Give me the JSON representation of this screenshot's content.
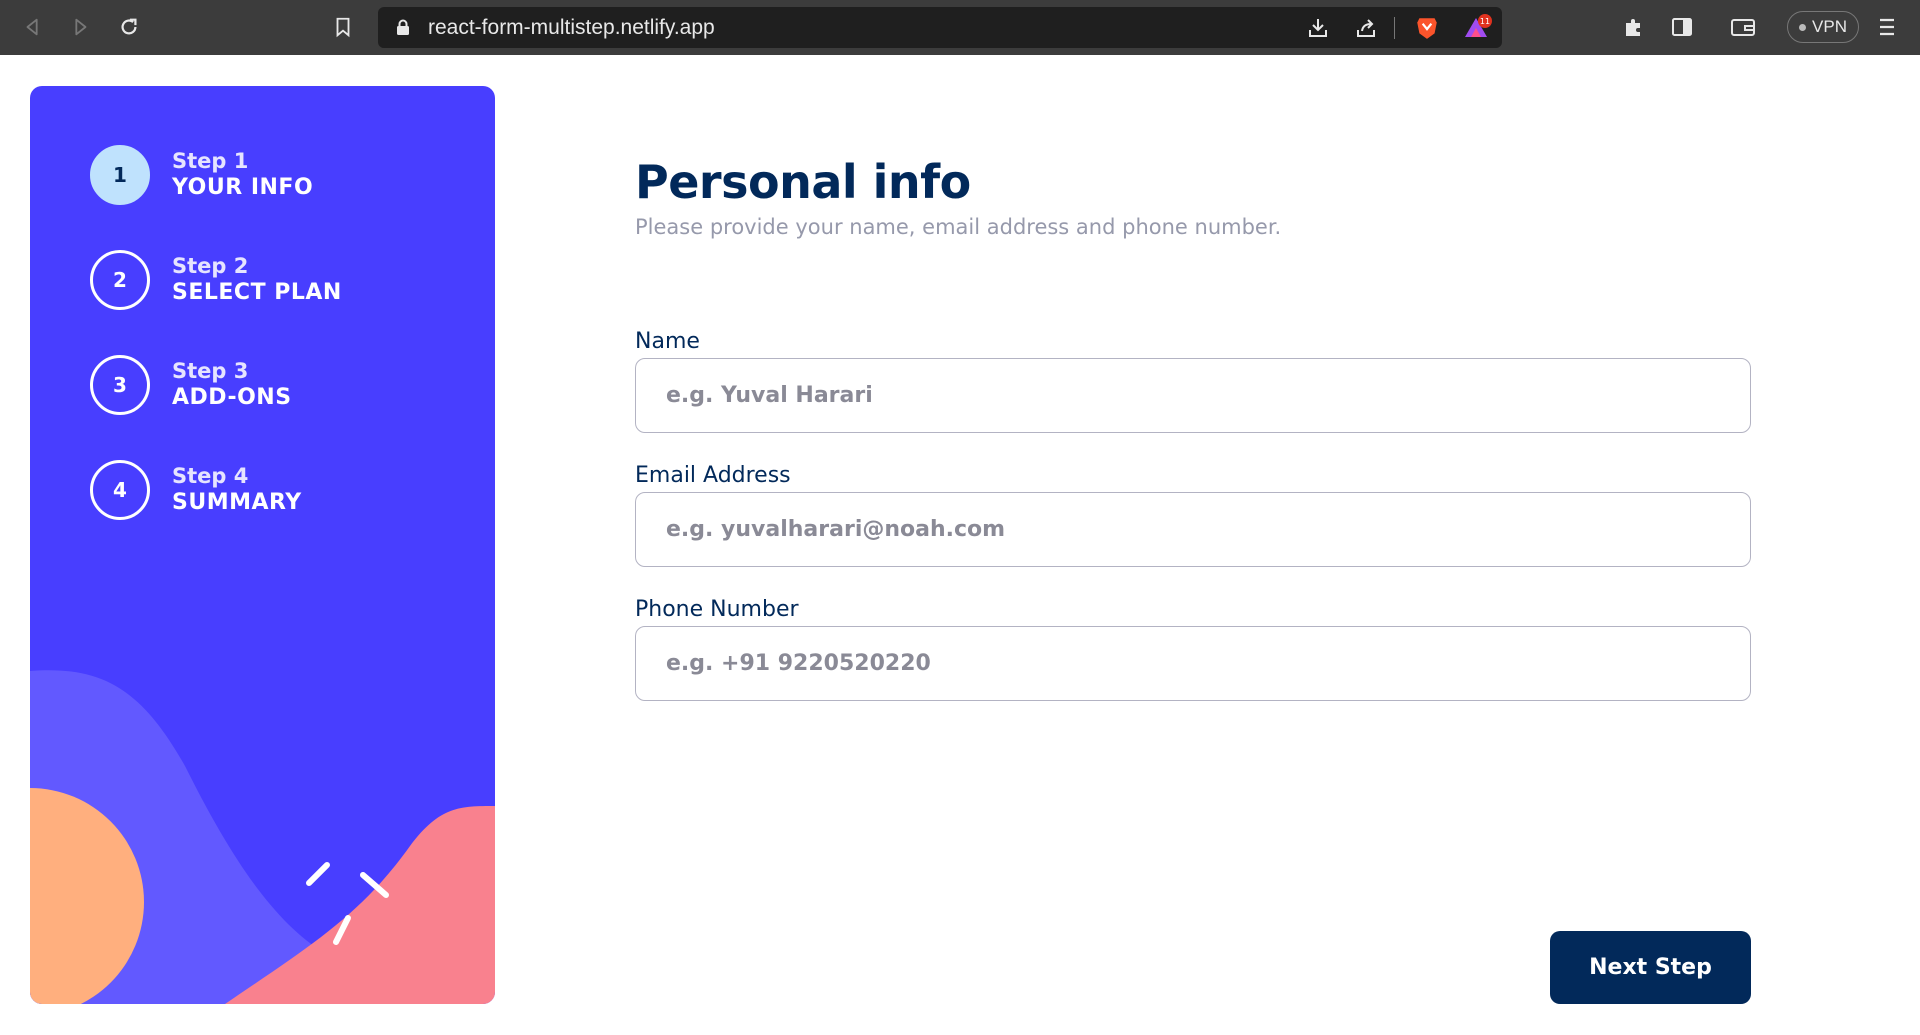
{
  "browser": {
    "url": "react-form-multistep.netlify.app",
    "vpn_label": "VPN",
    "notification_badge": "11"
  },
  "sidebar": {
    "steps": [
      {
        "number": "1",
        "label": "Step 1",
        "title": "YOUR INFO",
        "active": true
      },
      {
        "number": "2",
        "label": "Step 2",
        "title": "SELECT PLAN",
        "active": false
      },
      {
        "number": "3",
        "label": "Step 3",
        "title": "ADD-ONS",
        "active": false
      },
      {
        "number": "4",
        "label": "Step 4",
        "title": "SUMMARY",
        "active": false
      }
    ]
  },
  "form": {
    "title": "Personal info",
    "subtitle": "Please provide your name, email address and phone number.",
    "name": {
      "label": "Name",
      "placeholder": "e.g. Yuval Harari",
      "value": ""
    },
    "email": {
      "label": "Email Address",
      "placeholder": "e.g. yuvalharari@noah.com",
      "value": ""
    },
    "phone": {
      "label": "Phone Number",
      "placeholder": "e.g. +91 9220520220",
      "value": ""
    },
    "next_label": "Next Step"
  },
  "colors": {
    "sidebar_bg": "#483eff",
    "accent_dark": "#02295a",
    "active_step": "#bfe2fd",
    "decor_orange": "#ffaf7e",
    "decor_pink": "#f9818e",
    "decor_purple": "#6259ff"
  }
}
